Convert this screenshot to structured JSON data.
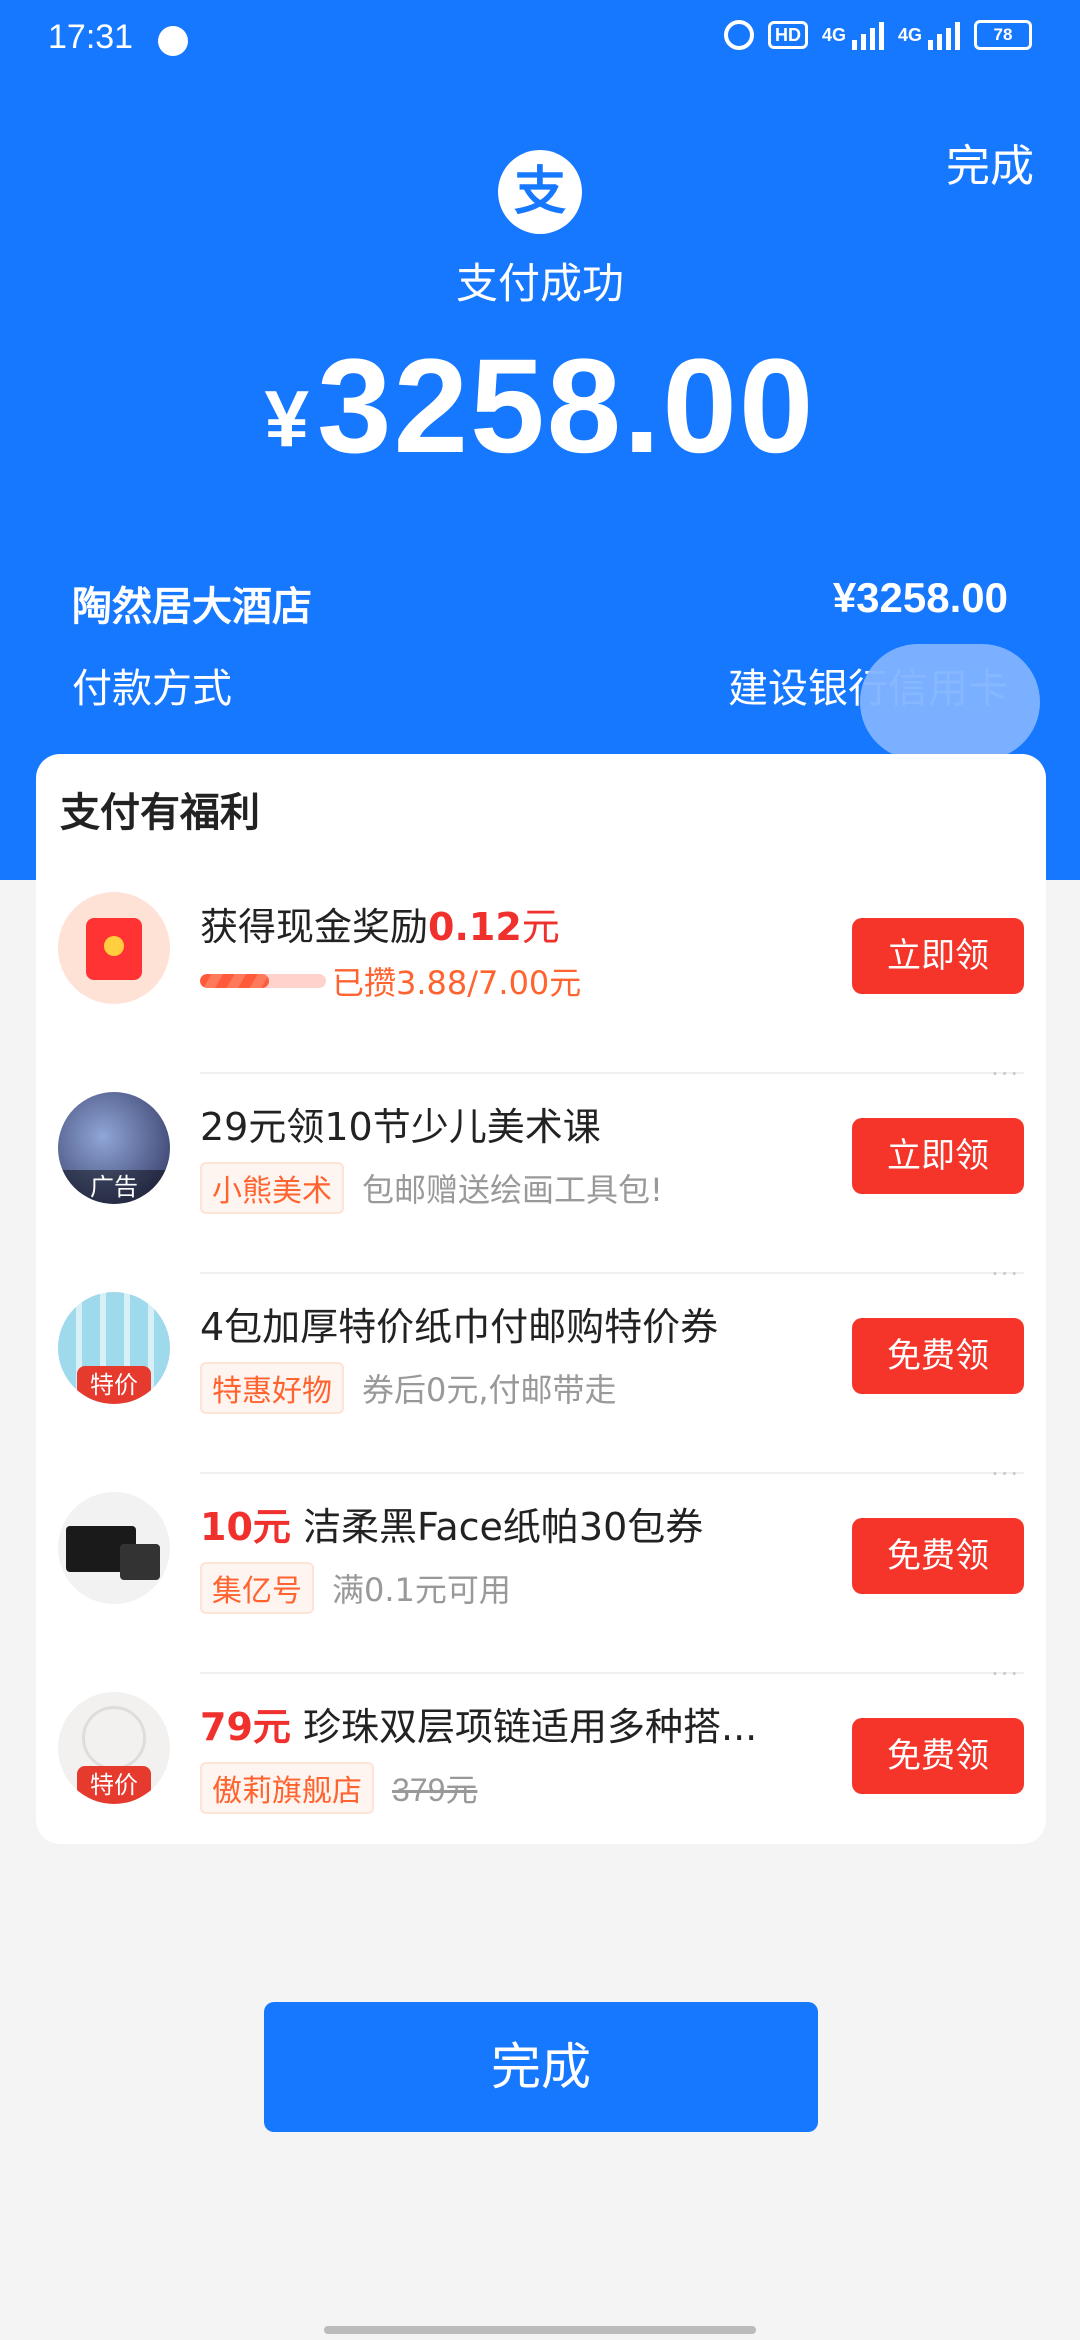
{
  "status_bar": {
    "time": "17:31",
    "hd_label": "HD",
    "network_1": "4G",
    "network_2": "4G",
    "battery": "78"
  },
  "header": {
    "done_label": "完成",
    "logo_char": "支",
    "title": "支付成功",
    "currency": "¥",
    "amount": "3258.00",
    "merchant": "陶然居大酒店",
    "merchant_amount": "¥3258.00",
    "payment_method_label": "付款方式",
    "payment_method_value": "建设银行信用卡"
  },
  "benefits": {
    "title": "支付有福利",
    "items": [
      {
        "title_prefix": "获得现金奖励",
        "title_highlight": "0.12",
        "title_suffix": "元",
        "progress_text": "已攒3.88/7.00元",
        "progress": 0.55,
        "button": "立即领",
        "icon": "red-envelope-icon"
      },
      {
        "title": "29元领10节少儿美术课",
        "tag": "小熊美术",
        "desc": "包邮赠送绘画工具包!",
        "badge": "广告",
        "button": "立即领",
        "icon": "art-class-thumbnail"
      },
      {
        "title": "4包加厚特价纸巾付邮购特价券",
        "tag": "特惠好物",
        "desc": "券后0元,付邮带走",
        "badge": "特价",
        "button": "免费领",
        "icon": "tissue-thumbnail"
      },
      {
        "price": "10元",
        "title": "洁柔黑Face纸帕30包券",
        "tag": "集亿号",
        "desc": "满0.1元可用",
        "button": "免费领",
        "icon": "face-tissue-thumbnail"
      },
      {
        "price": "79元",
        "title": "珍珠双层项链适用多种搭...",
        "tag": "傲莉旗舰店",
        "original_price": "379元",
        "badge": "特价",
        "button": "免费领",
        "icon": "necklace-thumbnail"
      }
    ],
    "more_icon": "···"
  },
  "bottom": {
    "done_label": "完成"
  },
  "colors": {
    "brand_blue": "#1677ff",
    "action_red": "#f5342a",
    "tag_orange": "#ff6430"
  }
}
